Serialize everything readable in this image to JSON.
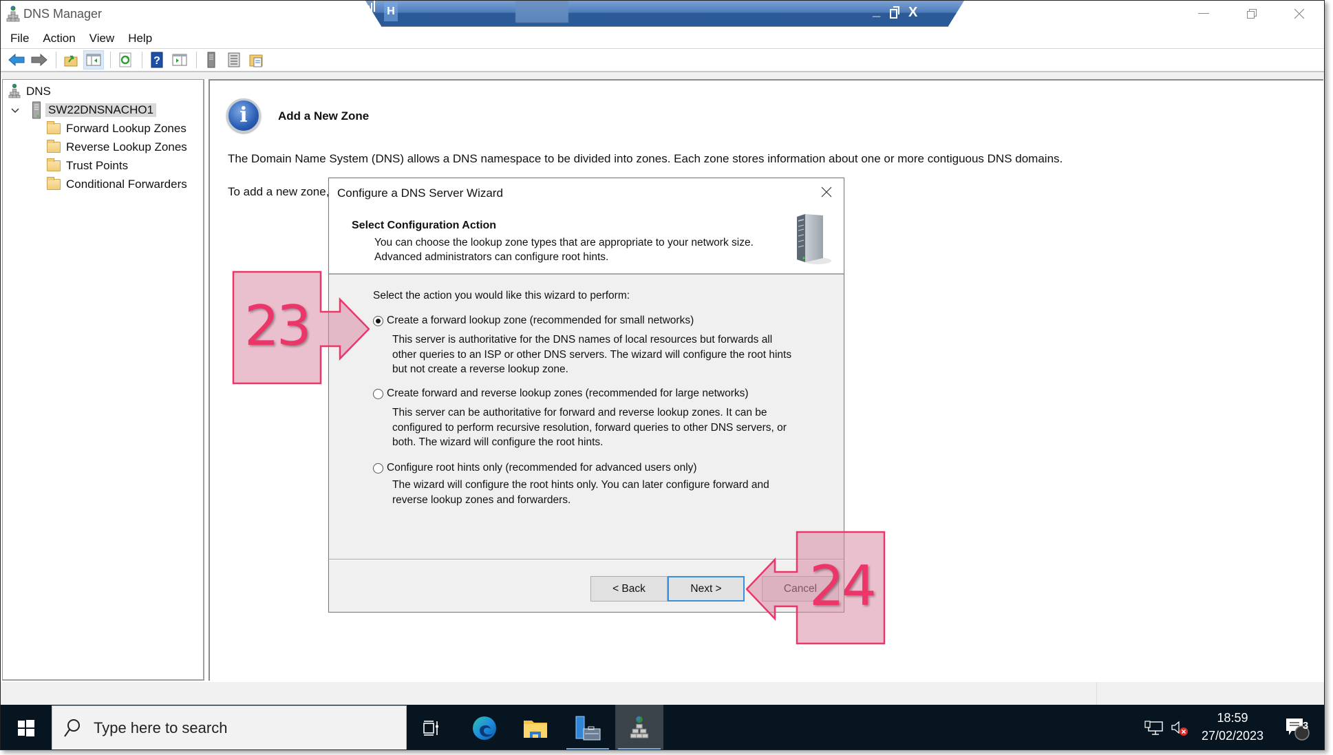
{
  "window": {
    "title": "DNS Manager",
    "controls": {
      "minimize": "minimize-icon",
      "restore": "restore-icon",
      "close": "close-icon"
    }
  },
  "remote_bar": {
    "pin_label": "H",
    "icons": [
      "pin-icon",
      "signal-icon",
      "minimize-icon",
      "restore-icon",
      "close-icon"
    ],
    "close_label": "X"
  },
  "menu": [
    "File",
    "Action",
    "View",
    "Help"
  ],
  "toolbar": {
    "buttons": [
      "back-icon",
      "forward-icon",
      "up-folder-icon",
      "show-hide-tree-icon",
      "refresh-icon",
      "help-icon",
      "show-hide-action-pane-icon",
      "server-icon",
      "list-icon",
      "properties-icon"
    ]
  },
  "tree": {
    "root": "DNS",
    "server": "SW22DNSNACHO1",
    "children": [
      "Forward Lookup Zones",
      "Reverse Lookup Zones",
      "Trust Points",
      "Conditional Forwarders"
    ]
  },
  "content": {
    "icon_glyph": "i",
    "title": "Add a New Zone",
    "description": "The Domain Name System (DNS) allows a DNS namespace to be divided into zones. Each zone stores information about one or more contiguous DNS domains.",
    "add_text": "To add a new zone,"
  },
  "dialog": {
    "title": "Configure a DNS Server Wizard",
    "header_title": "Select Configuration Action",
    "header_sub_1": "You can choose the lookup zone types that are appropriate to your network size.",
    "header_sub_2": "Advanced administrators can configure root hints.",
    "prompt": "Select the action you would like this wizard to perform:",
    "options": [
      {
        "label": "Create a forward lookup zone (recommended for small networks)",
        "checked": true,
        "desc": [
          "This server is authoritative for the DNS names of local resources but forwards all",
          "other queries to an ISP or other DNS servers. The wizard will configure the root hints",
          "but not create a reverse lookup zone."
        ]
      },
      {
        "label": "Create forward and reverse lookup zones (recommended for large networks)",
        "checked": false,
        "desc": [
          "This server can be authoritative for forward and reverse lookup zones. It can be",
          "configured to perform recursive resolution, forward queries to other DNS servers, or",
          "both. The wizard will configure the root hints."
        ]
      },
      {
        "label": "Configure root hints only (recommended for advanced users only)",
        "checked": false,
        "desc": [
          "The wizard will configure the root hints only. You can later configure forward and",
          "reverse lookup zones and forwarders."
        ]
      }
    ],
    "buttons": {
      "back": "< Back",
      "next": "Next >",
      "cancel": "Cancel"
    }
  },
  "annotations": {
    "step_a": "23",
    "step_b": "24",
    "color": "#ec3669",
    "fill": "#e8b3c3"
  },
  "taskbar": {
    "search_placeholder": "Type here to search",
    "apps": [
      "task-view-icon",
      "edge-icon",
      "file-explorer-icon",
      "server-manager-icon",
      "dns-manager-icon"
    ],
    "time": "18:59",
    "date": "27/02/2023",
    "notification_count": "3"
  }
}
